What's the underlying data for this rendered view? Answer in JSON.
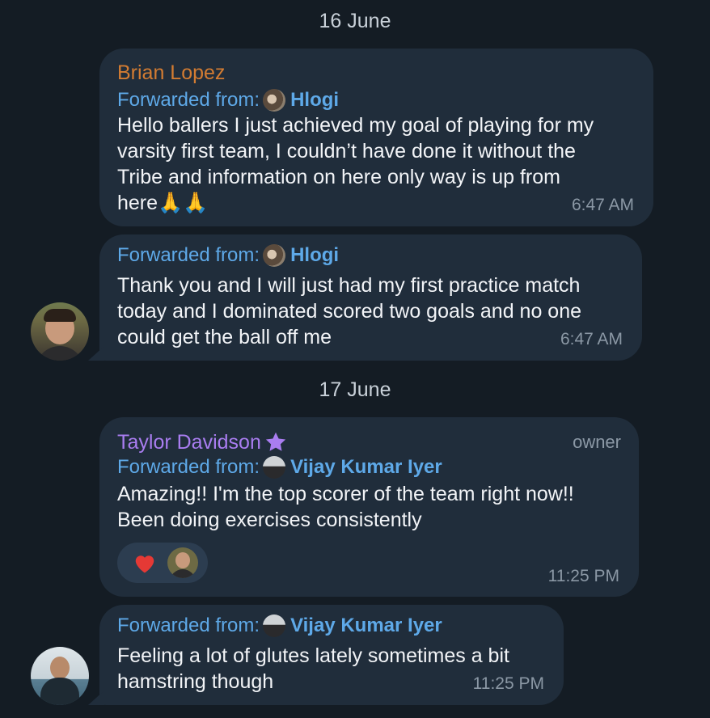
{
  "dates": [
    "16 June",
    "17 June"
  ],
  "messages": [
    {
      "sender": "Brian Lopez",
      "sender_color": "#d37c32",
      "fwd_label": "Forwarded from:",
      "fwd_name": "Hlogi",
      "lines": [
        "Hello ballers I just achieved my goal of playing for my",
        "varsity first team, I couldn’t have done it without the",
        "Tribe and information on here only way is up from",
        "here🙏🙏"
      ],
      "time": "6:47 AM"
    },
    {
      "fwd_label": "Forwarded from:",
      "fwd_name": "Hlogi",
      "lines": [
        "Thank you and I will just had my first practice match",
        "today and I dominated scored two goals and no one",
        "could get the ball off me"
      ],
      "time": "6:47 AM"
    },
    {
      "sender": "Taylor Davidson",
      "sender_color": "#a97df0",
      "badge_icon": "star-icon",
      "role": "owner",
      "fwd_label": "Forwarded from:",
      "fwd_name": "Vijay Kumar Iyer",
      "lines": [
        "Amazing!! I'm the top scorer of the team right now!!",
        "Been doing exercises consistently"
      ],
      "reaction": {
        "icon": "heart-icon",
        "color": "#e53935"
      },
      "time": "11:25 PM"
    },
    {
      "fwd_label": "Forwarded from:",
      "fwd_name": "Vijay Kumar Iyer",
      "lines": [
        "Feeling a lot of glutes lately sometimes a bit",
        "hamstring though"
      ],
      "time": "11:25 PM"
    }
  ],
  "colors": {
    "background": "#141c24",
    "bubble": "#202d3b",
    "link": "#5ea9e8",
    "text": "#f2f4f7",
    "meta": "#8b98a5"
  }
}
